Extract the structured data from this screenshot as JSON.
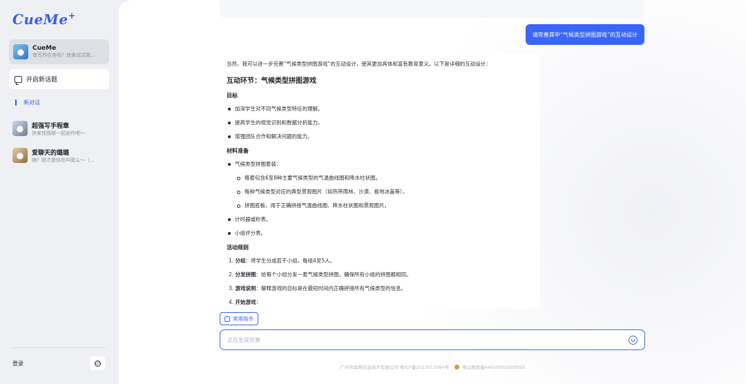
{
  "app": {
    "logo": "CueMe",
    "logo_mark": "+"
  },
  "sidebar": {
    "active_agent": {
      "name": "CueMe",
      "subtitle": "有写作任务吗？快来试试我..."
    },
    "new_topic_label": "开启新话题",
    "new_chat_label": "新对话",
    "contacts": [
      {
        "name": "超强写手程章",
        "subtitle": "快来找我聊一起创作吧～"
      },
      {
        "name": "爱聊天的璐璐",
        "subtitle": "嗨？刚才是你在叫我么～（..."
      }
    ],
    "login_label": "登录",
    "info_icon": "ⓘ"
  },
  "chat": {
    "user_message": "请完善其中“气候类型拼图游戏”的互动设计",
    "answer": {
      "intro": "当然，我可以进一步完善“气候类型拼图游戏”的互动设计，使其更加具体和富有教育意义。以下是详细的互动设计：",
      "title": "互动环节：气候类型拼图游戏",
      "goal_heading": "目标",
      "goals": [
        "加深学生对不同气候类型特征的理解。",
        "提高学生的视觉识别和数据分析能力。",
        "增强团队合作和解决问题的能力。"
      ],
      "materials_heading": "材料准备",
      "materials_main": "气候类型拼图套装：",
      "materials_sub": [
        "每套包含6至8种主要气候类型的气温曲线图和降水柱状图。",
        "每种气候类型对应的典型景观图片（如热带雨林、沙漠、极地冰盖等）。",
        "拼图底板，用于正确拼接气温曲线图、降水柱状图和景观图片。"
      ],
      "materials_more": [
        "计时器或秒表。",
        "小组评分表。"
      ],
      "rules_heading": "活动规则",
      "rules": [
        {
          "num": "1.",
          "label": "分组",
          "text": "：将学生分成若干小组，每组4至5人。"
        },
        {
          "num": "2.",
          "label": "分发拼图",
          "text": "：给每个小组分发一套气候类型拼图，确保所有小组的拼图都相同。"
        },
        {
          "num": "3.",
          "label": "游戏说明",
          "text": "：解释游戏的目标是在最短时间内正确拼接所有气候类型的信息。"
        },
        {
          "num": "4.",
          "label": "开始游戏",
          "text": "："
        }
      ]
    }
  },
  "composer": {
    "common_commands_label": "常用指令",
    "input_placeholder": "正在生成答案"
  },
  "footer": {
    "company": "广州市助晓信息技术有限公司 粤ICP备2022013084号",
    "police": "粤公网安备44010502003055"
  }
}
